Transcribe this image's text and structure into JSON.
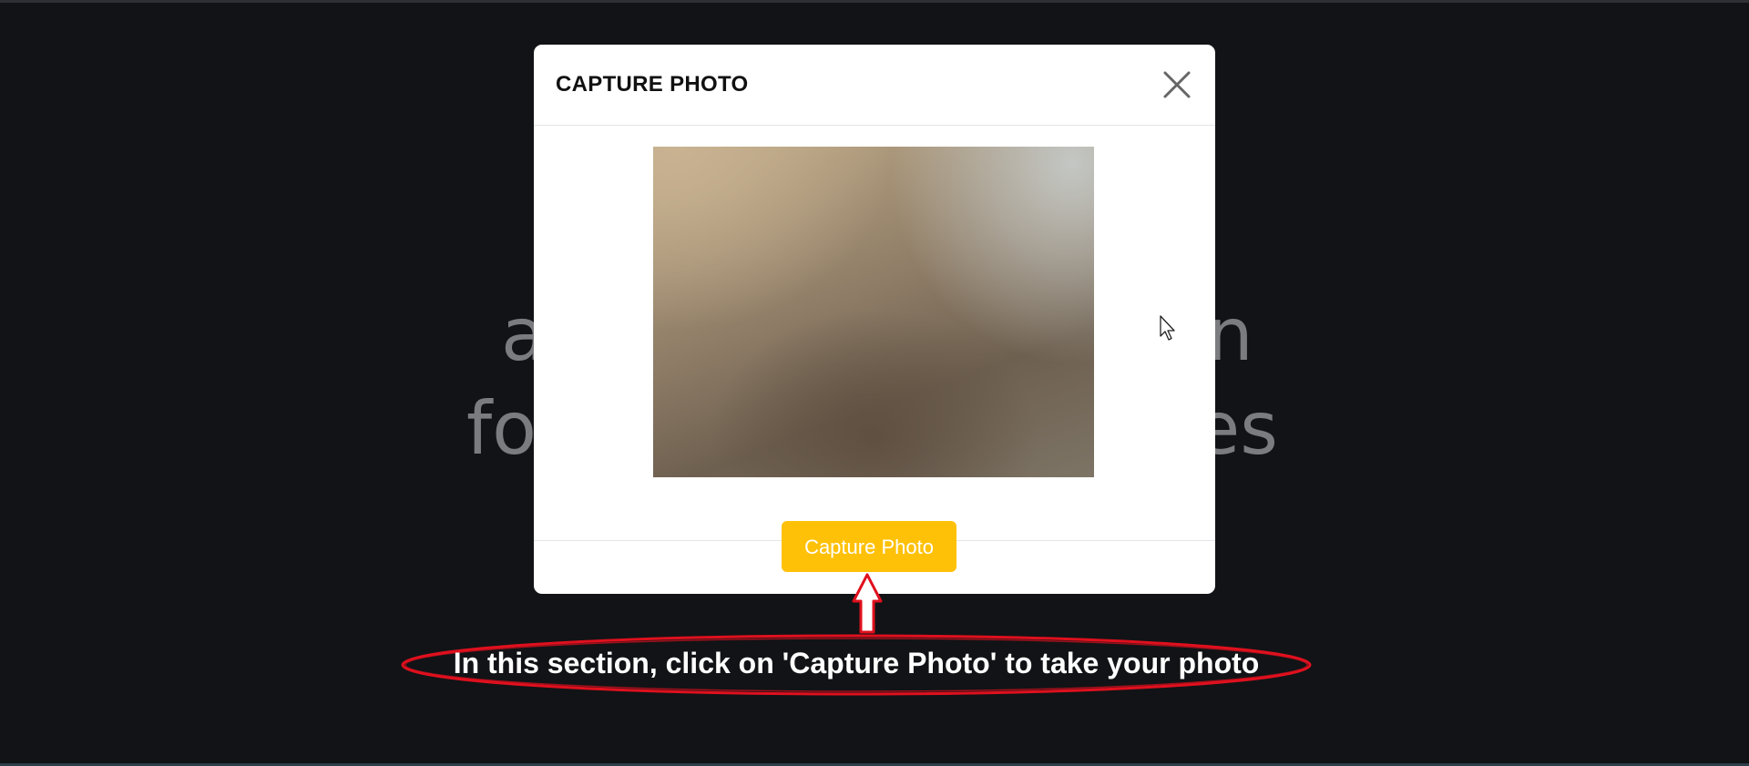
{
  "background": {
    "line1_left": "a",
    "line1_right": "n",
    "line2_left": "fo",
    "line2_right": "es"
  },
  "modal": {
    "title": "CAPTURE PHOTO",
    "close_icon": "close-icon",
    "capture_button_label": "Capture Photo",
    "accent_color": "#ffc107"
  },
  "annotation": {
    "text": "In this section, click on 'Capture Photo' to take your photo",
    "color": "#e0101e"
  }
}
